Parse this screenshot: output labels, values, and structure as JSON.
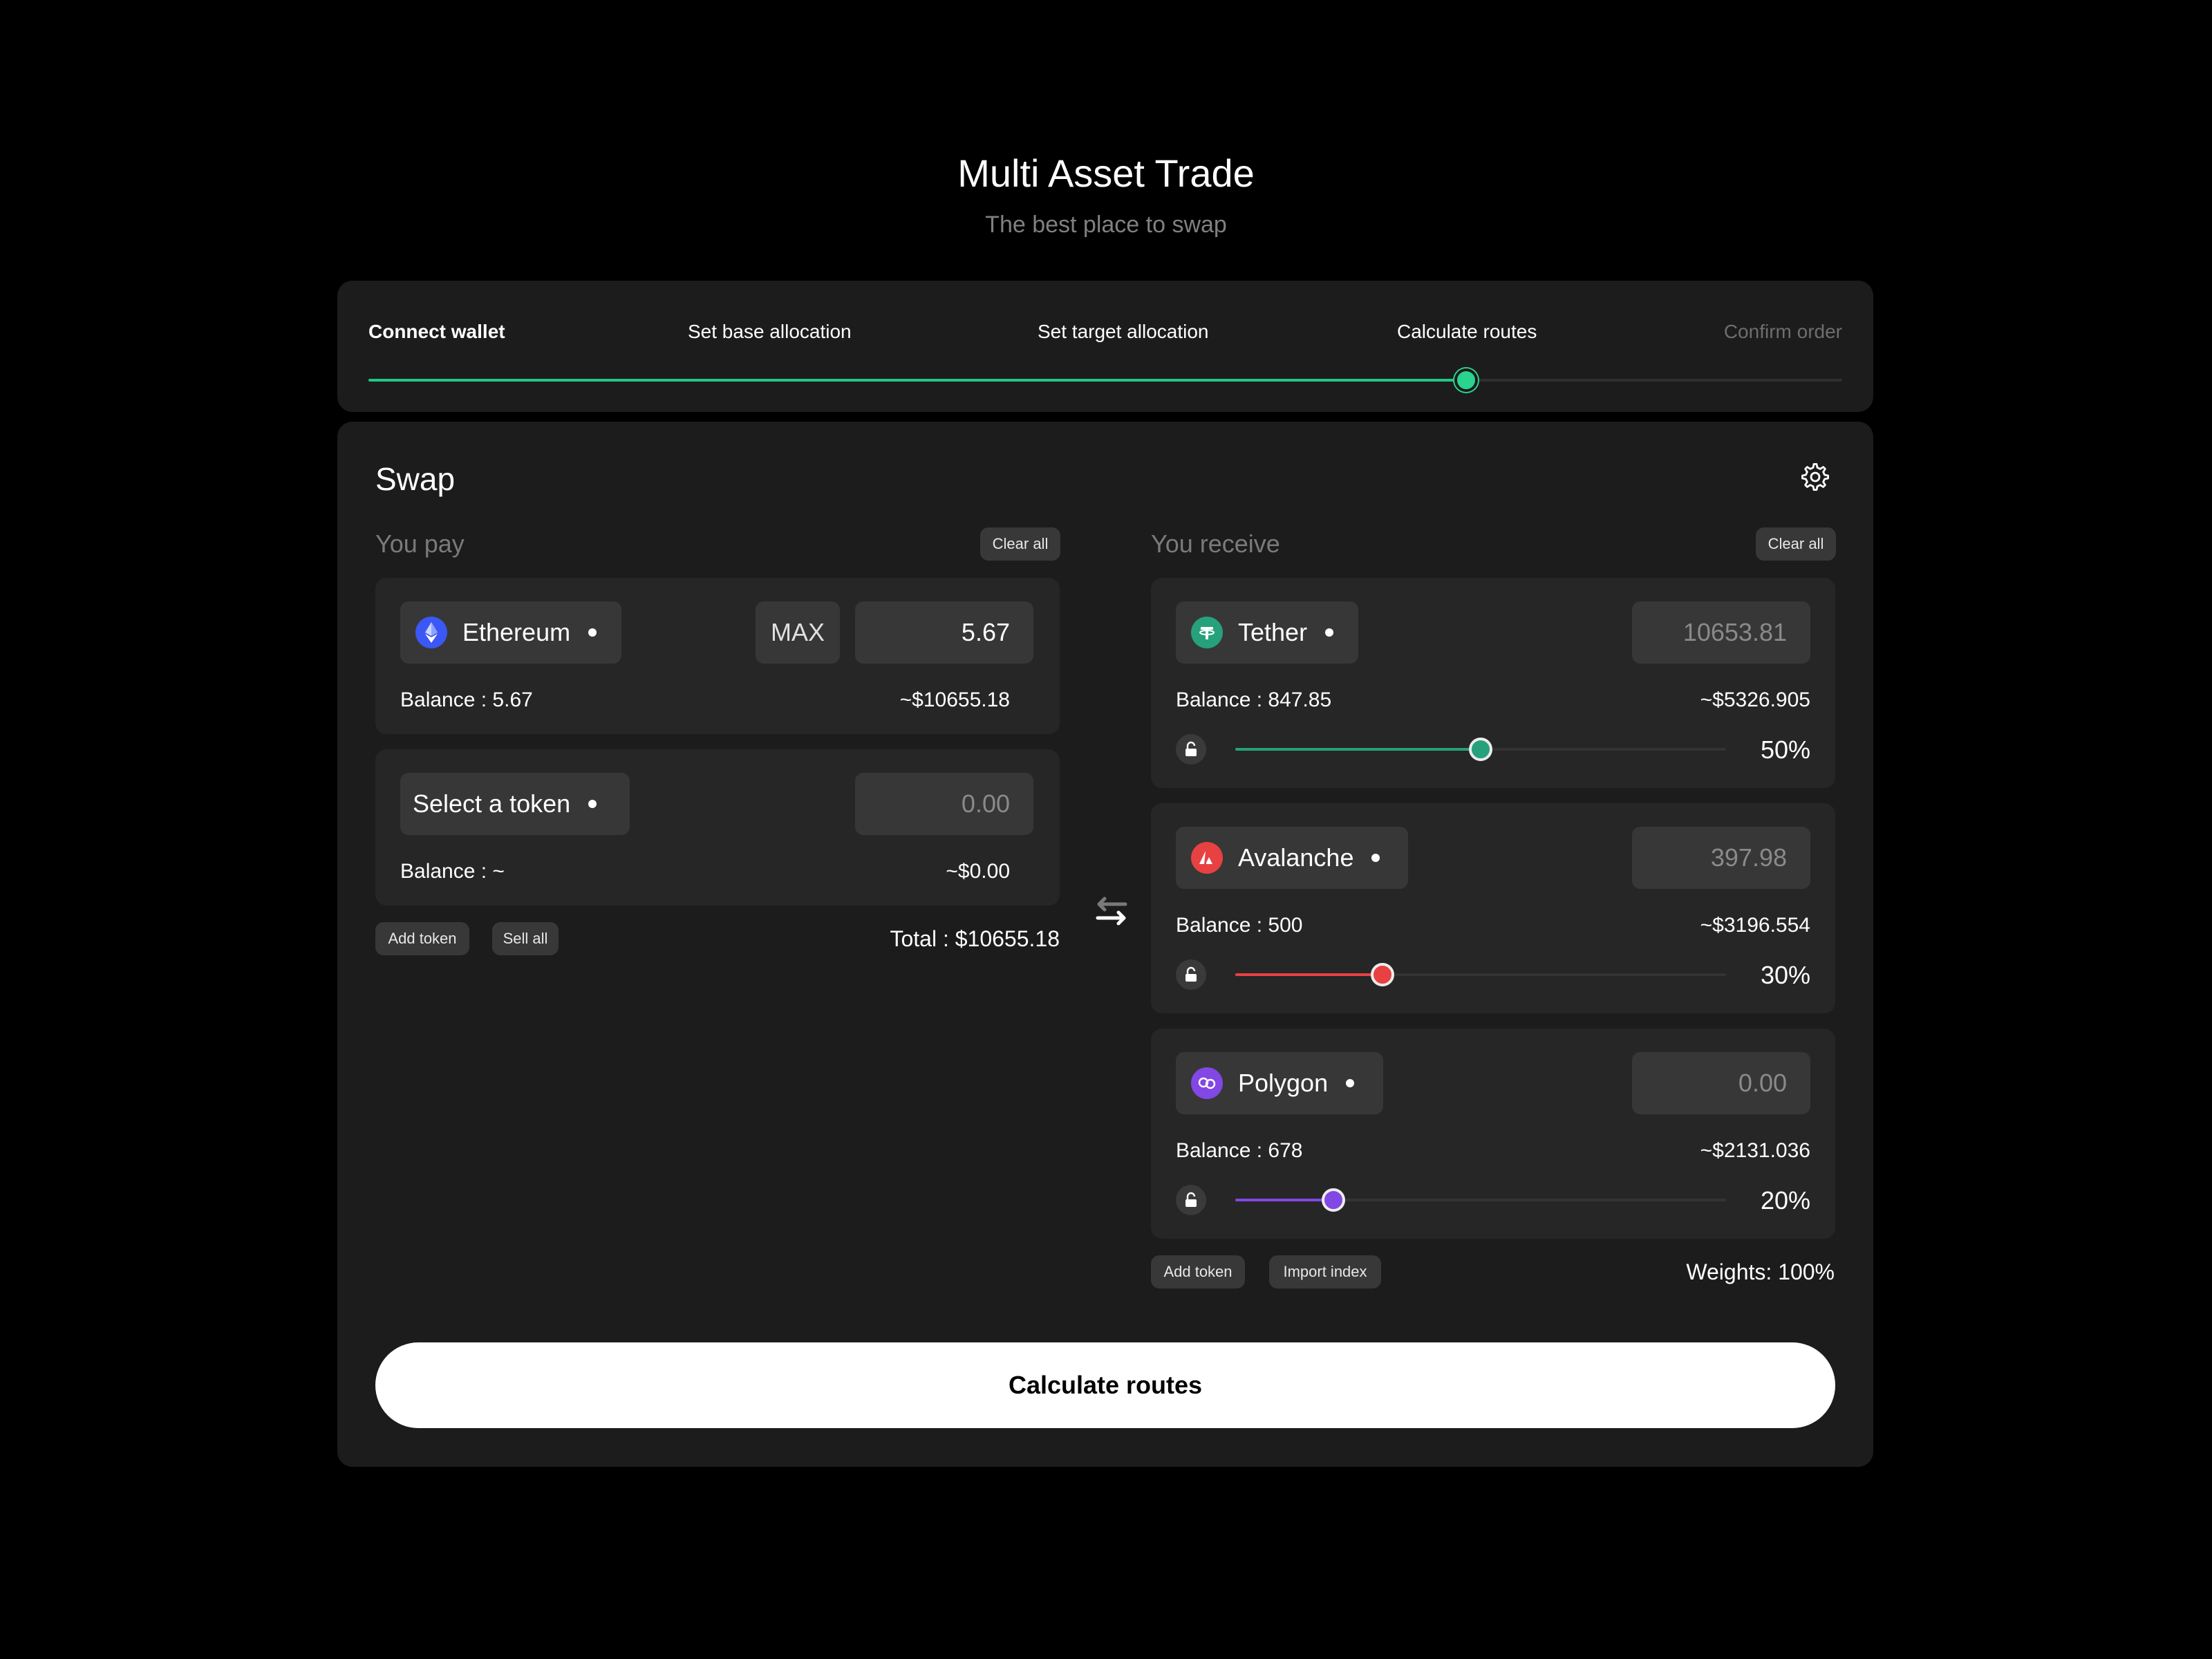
{
  "header": {
    "title": "Multi Asset Trade",
    "subtitle": "The best place to swap"
  },
  "stepper": {
    "steps": [
      {
        "label": "Connect wallet",
        "state": "done"
      },
      {
        "label": "Set base allocation",
        "state": "done"
      },
      {
        "label": "Set target allocation",
        "state": "done"
      },
      {
        "label": "Calculate routes",
        "state": "current"
      },
      {
        "label": "Confirm order",
        "state": "pending"
      }
    ],
    "progress": 0.745,
    "accent": "#21c785"
  },
  "swap": {
    "title": "Swap",
    "settings_icon": "gear-icon"
  },
  "pay": {
    "label": "You pay",
    "clear_label": "Clear all",
    "tokens": [
      {
        "name": "Ethereum",
        "icon": "ethereum-icon",
        "max_label": "MAX",
        "amount": "5.67",
        "balance": "Balance : 5.67",
        "usd": "~$10655.18"
      },
      {
        "name": "Select a token",
        "icon": "",
        "amount_placeholder": "0.00",
        "balance": "Balance : ~",
        "usd": "~$0.00"
      }
    ],
    "add_token_label": "Add token",
    "sell_all_label": "Sell all",
    "total": "Total : $10655.18"
  },
  "receive": {
    "label": "You receive",
    "clear_label": "Clear all",
    "tokens": [
      {
        "name": "Tether",
        "icon": "tether-icon",
        "color": "#26a17b",
        "amount": "10653.81",
        "balance": "Balance : 847.85",
        "usd": "~$5326.905",
        "weight": 0.5,
        "pct": "50%"
      },
      {
        "name": "Avalanche",
        "icon": "avalanche-icon",
        "color": "#e84142",
        "amount": "397.98",
        "balance": "Balance : 500",
        "usd": "~$3196.554",
        "weight": 0.3,
        "pct": "30%"
      },
      {
        "name": "Polygon",
        "icon": "polygon-icon",
        "color": "#8247e5",
        "amount": "0.00",
        "balance": "Balance : 678",
        "usd": "~$2131.036",
        "weight": 0.2,
        "pct": "20%"
      }
    ],
    "add_token_label": "Add token",
    "import_label": "Import index",
    "weights": "Weights: 100%"
  },
  "cta": {
    "label": "Calculate routes"
  }
}
